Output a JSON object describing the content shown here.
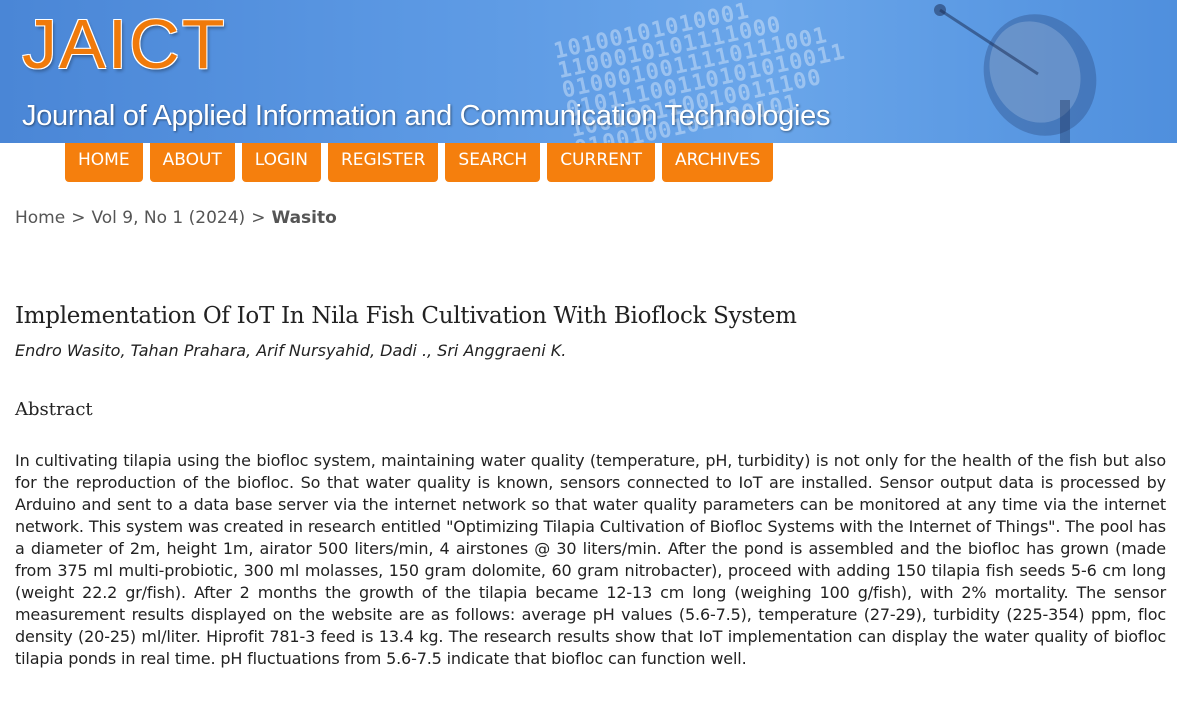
{
  "banner": {
    "logo": "JAICT",
    "subtitle": "Journal of Applied Information and Communication Technologies",
    "binary_deco": [
      "10100101010001",
      "1100010101111000",
      "0100010011110111001",
      "01011100110101010011",
      "100100110010011100",
      "0100100101100101"
    ]
  },
  "nav": {
    "items": [
      {
        "label": "HOME"
      },
      {
        "label": "ABOUT"
      },
      {
        "label": "LOGIN"
      },
      {
        "label": "REGISTER"
      },
      {
        "label": "SEARCH"
      },
      {
        "label": "CURRENT"
      },
      {
        "label": "ARCHIVES"
      }
    ]
  },
  "breadcrumb": {
    "home": "Home",
    "sep": ">",
    "issue": "Vol 9, No 1 (2024)",
    "current": "Wasito"
  },
  "article": {
    "title": "Implementation Of IoT In Nila Fish Cultivation With Bioflock System",
    "authors": "Endro Wasito, Tahan Prahara, Arif Nursyahid, Dadi ., Sri Anggraeni K.",
    "abstract_heading": "Abstract",
    "abstract": "In cultivating tilapia using the biofloc system, maintaining water quality (temperature, pH, turbidity) is not only for the health of the fish but also for the reproduction of the biofloc. So that water quality is known, sensors connected to IoT are installed. Sensor output data is processed by Arduino and sent to a data base server via the internet network so that water quality parameters can be monitored at any time via the internet network. This system was created in research entitled \"Optimizing Tilapia Cultivation of Biofloc Systems with the Internet of Things\". The pool has a diameter of 2m, height 1m, airator 500 liters/min, 4 airstones @ 30 liters/min. After the pond is assembled and the biofloc has grown (made from 375 ml multi-probiotic, 300 ml molasses, 150 gram dolomite, 60 gram nitrobacter), proceed with adding 150 tilapia fish seeds 5-6 cm long (weight 22.2 gr/fish). After 2 months the growth of the tilapia became 12-13 cm long (weighing 100 g/fish), with 2% mortality. The sensor measurement results displayed on the website are as follows: average pH values (5.6-7.5), temperature (27-29), turbidity (225-354) ppm, floc density (20-25) ml/liter. Hiprofit 781-3 feed is 13.4 kg. The research results show that IoT implementation can display the water quality of biofloc tilapia ponds in real time. pH fluctuations from 5.6-7.5 indicate that biofloc can function well."
  },
  "colors": {
    "banner_blue": "#5b98e3",
    "nav_orange": "#f57f0d",
    "logo_orange": "#f07a0a"
  }
}
